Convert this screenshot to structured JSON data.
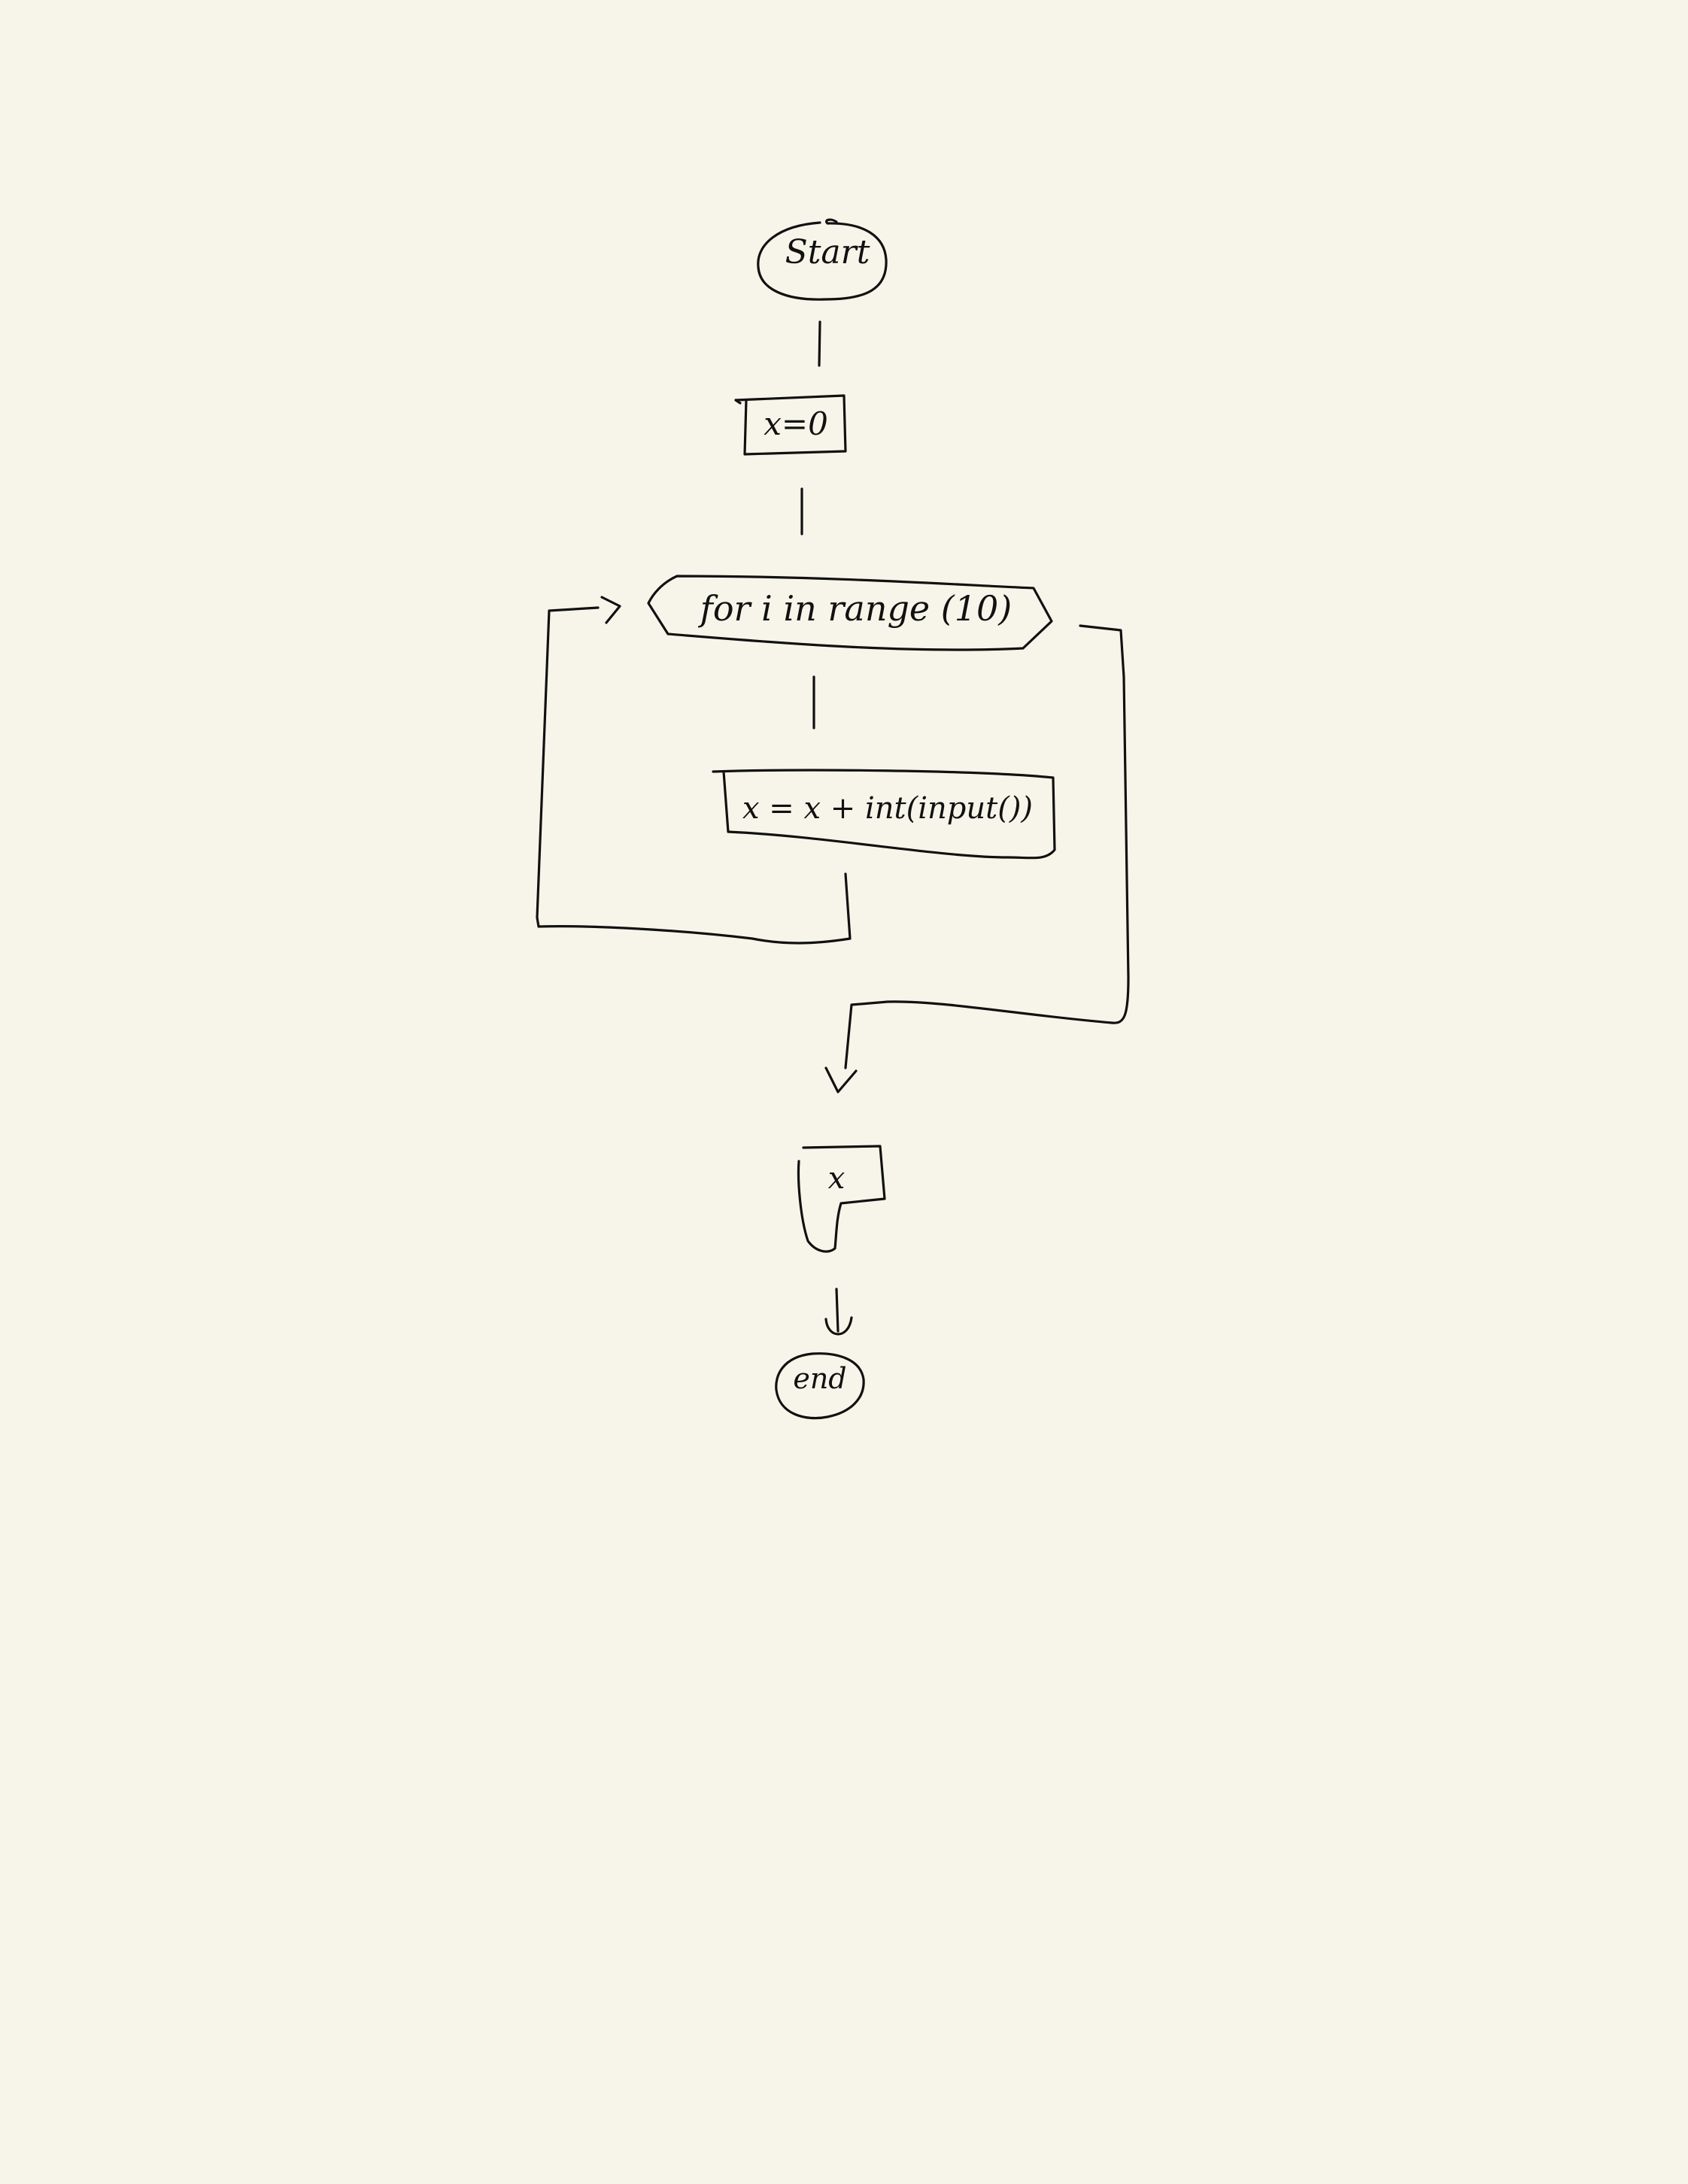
{
  "page": {
    "background_color": "#f7f5ea",
    "ink_color": "#111111"
  },
  "flowchart": {
    "start": {
      "label": "Start",
      "shape": "terminal"
    },
    "init": {
      "label": "x=0",
      "shape": "process"
    },
    "loop": {
      "label": "for i in range (10)",
      "shape": "loop-hexagon"
    },
    "body": {
      "label": "x = x + int(input())",
      "shape": "process"
    },
    "output": {
      "label": "x",
      "shape": "output-document"
    },
    "end": {
      "label": "end",
      "shape": "terminal"
    }
  }
}
